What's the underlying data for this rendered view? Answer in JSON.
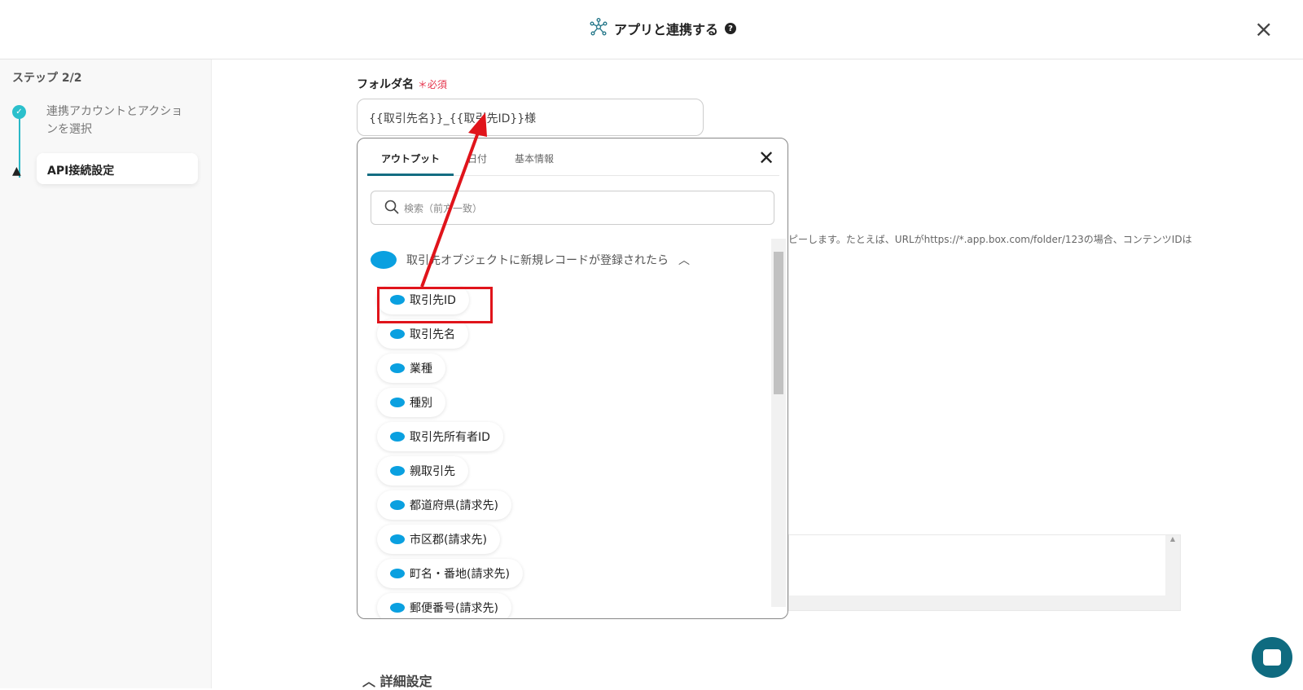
{
  "header": {
    "title": "アプリと連携する",
    "help": "?",
    "close": "×"
  },
  "sidebar": {
    "step_label": "ステップ 2/2",
    "steps": [
      {
        "label": "連携アカウントとアクションを選択",
        "status": "done"
      },
      {
        "label": "API接続設定",
        "status": "warning"
      }
    ]
  },
  "form": {
    "folder_label": "フォルダ名",
    "required": "＊必須",
    "folder_value": "{{取引先名}}_{{取引先ID}}様",
    "help_text": "ピーします。たとえば、URLがhttps://*.app.box.com/folder/123の場合、コンテンツIDは",
    "detail_label": "詳細設定"
  },
  "popup": {
    "tabs": [
      "アウトプット",
      "日付",
      "基本情報"
    ],
    "search_placeholder": "検索（前方一致）",
    "group_title": "取引先オブジェクトに新規レコードが登録されたら",
    "items": [
      "取引先ID",
      "取引先名",
      "業種",
      "種別",
      "取引先所有者ID",
      "親取引先",
      "都道府県(請求先)",
      "市区郡(請求先)",
      "町名・番地(請求先)",
      "郵便番号(請求先)"
    ]
  },
  "colors": {
    "accent": "#136d82",
    "salesforce": "#0aa0e0",
    "annotation": "#e0141b"
  }
}
